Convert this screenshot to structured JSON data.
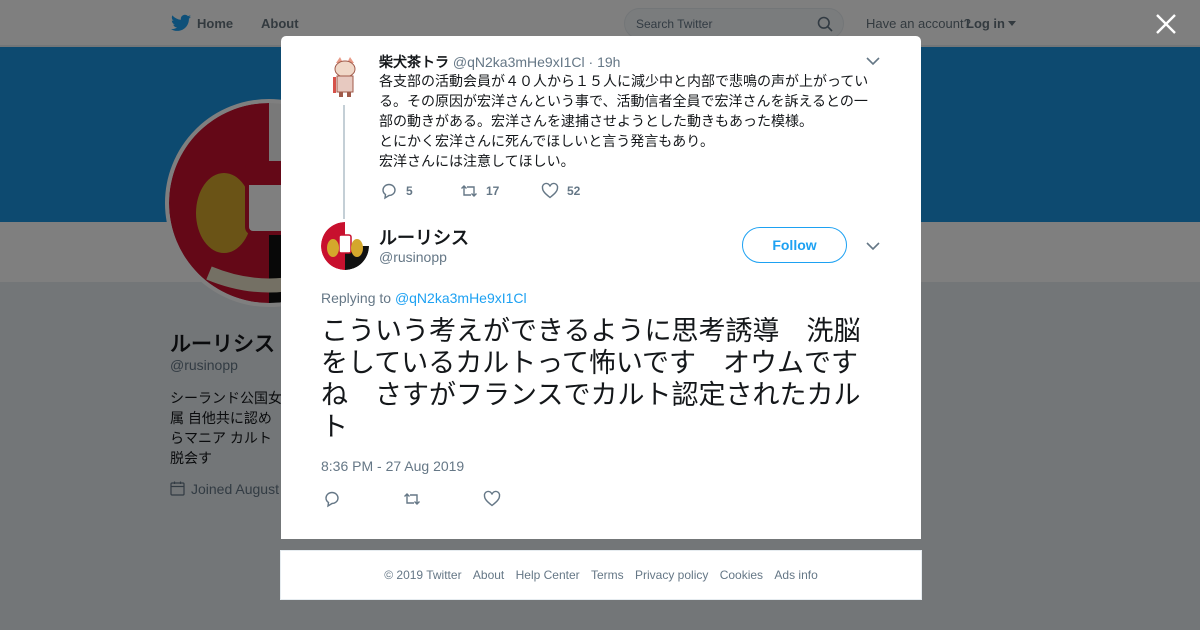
{
  "nav": {
    "home": "Home",
    "about": "About",
    "search_placeholder": "Search Twitter",
    "have_account": "Have an account?",
    "login": "Log in"
  },
  "profile": {
    "name": "ルーリシス",
    "handle": "@rusinopp",
    "bio": "シーランド公国女属 自他共に認めらマニア カルト脱会す",
    "joined": "Joined August"
  },
  "parent_tweet": {
    "name": "柴犬茶トラ",
    "handle": "@qN2ka3mHe9xI1Cl",
    "separator": "·",
    "time": "19h",
    "lines": [
      "各支部の活動会員が４０人から１５人に減少中と内部で悲鳴の声が上がっている。その原因が宏洋さんという事で、活動信者全員で宏洋さんを訴えるとの一部の動きがある。宏洋さんを逮捕させようとした動きもあった模様。",
      "とにかく宏洋さんに死んでほしいと言う発言もあり。",
      "宏洋さんには注意してほしい。"
    ],
    "replies": "5",
    "retweets": "17",
    "likes": "52"
  },
  "main_tweet": {
    "name": "ルーリシス",
    "handle": "@rusinopp",
    "follow_label": "Follow",
    "replying_label": "Replying to",
    "replying_handle": "@qN2ka3mHe9xI1Cl",
    "text": "こういう考えができるように思考誘導　洗脳をしているカルトって怖いです　オウムですね　さすがフランスでカルト認定されたカルト",
    "timestamp": "8:36 PM - 27 Aug 2019"
  },
  "footer": {
    "copyright": "© 2019 Twitter",
    "links": [
      "About",
      "Help Center",
      "Terms",
      "Privacy policy",
      "Cookies",
      "Ads info"
    ]
  },
  "colors": {
    "brand": "#1da1f2",
    "banner": "#1b95e0",
    "muted": "#657786"
  }
}
